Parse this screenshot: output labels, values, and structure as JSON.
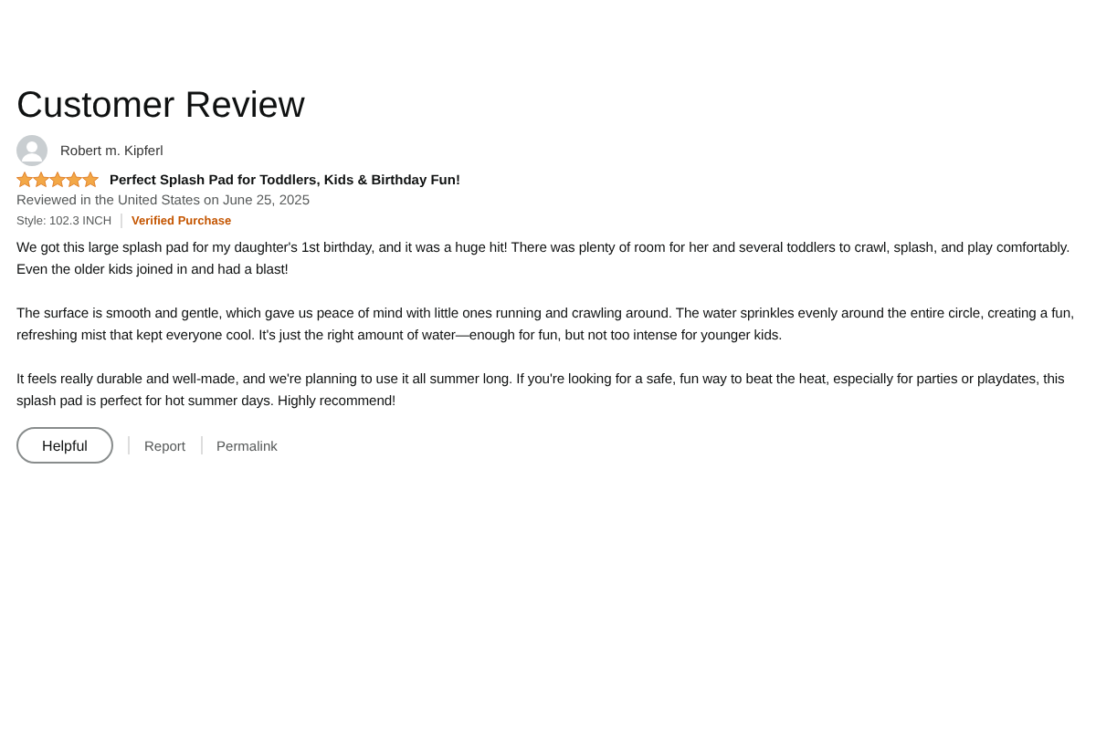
{
  "title": "Customer Review",
  "review": {
    "reviewer": "Robert m. Kipferl",
    "stars": 5,
    "headline": "Perfect Splash Pad for Toddlers, Kids & Birthday Fun!",
    "meta": "Reviewed in the United States on June 25, 2025",
    "style": "Style: 102.3 INCH",
    "verified": "Verified Purchase",
    "paragraphs": [
      "We got this large splash pad for my daughter's 1st birthday, and it was a huge hit! There was plenty of room for her and several toddlers to crawl, splash, and play comfortably. Even the older kids joined in and had a blast!",
      "The surface is smooth and gentle, which gave us peace of mind with little ones running and crawling around. The water sprinkles evenly around the entire circle, creating a fun, refreshing mist that kept everyone cool. It's just the right amount of water—enough for fun, but not too intense for younger kids.",
      "It feels really durable and well-made, and we're planning to use it all summer long. If you're looking for a safe, fun way to beat the heat, especially for parties or playdates, this splash pad is perfect for hot summer days. Highly recommend!"
    ]
  },
  "actions": {
    "helpful": "Helpful",
    "links": [
      "Report",
      "Permalink"
    ]
  }
}
